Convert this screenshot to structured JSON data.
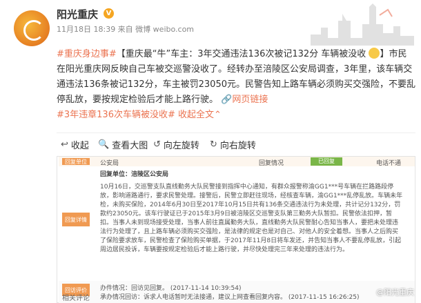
{
  "account": {
    "name": "阳光重庆",
    "verified_mark": "V",
    "meta": "11月18日 18:39 来自 微博 weibo.com"
  },
  "post": {
    "tag1": "#重庆身边事#",
    "headline": "【重庆最“牛”车主：3年交通违法136次被记132分 车辆被没收",
    "body": "】市民在阳光重庆网反映自己车被交巡警没收了。经转办至涪陵区公安局调查，3年里，该车辆交通违法136条被记132分，车主被罚23050元。民警告知上路车辆必须购买交强险，不要乱停乱放，要按规定检验后才能上路行驶。",
    "link": "网页链接",
    "tag2": "#3年违章136次车辆被没收#",
    "collapse": "收起全文"
  },
  "actions": {
    "collapse": "收起",
    "view_large": "查看大图",
    "rotate_left": "向左旋转",
    "rotate_right": "向右旋转"
  },
  "shot": {
    "gov_label": "回复单位",
    "gov": "公安局",
    "status": "回复情况",
    "status_badge": "已回复",
    "t2": "电话不通",
    "reply_label": "回复详情",
    "reply_unit": "回复单位：涪陵区公安局",
    "reply_text": "10月16日，交巡警支队直线勤务大队民警接到指挥中心通知，有群众报警称渝GG1***号车辆在拦路路段停放，影响道路通行，要求民警处理。接警后，民警立即赶往现场，经核查车辆，渝GG1***乱停乱放。车辆未年检，未购买保险，2014年6月30日至2017年10月15日共有136条交通违法行为未处理，共计记分132分，罚款约23050元。该车行驶证已于2015年3月9日被涪陵区交巡警支队第三勤务大队暂扣。民警依法扣押，暂扣。当事人未到现场接受处理，当事人前往直属勤务大队，直线勤务大队民警耐心告知当事人，要把未处理违法行为处理了，且上路车辆必须购买交强险，是法律的规定也是对自己、对他人的安全着想。当事人之后购买了保险要求放车，民警检查了保险购买单据，于2017年11月8日将车发还，并告知当事人不要乱停乱放，引起周边居民投诉，车辆要按规定检验后才能上路行驶，并尽快处理完三年来处理的违法行为。",
    "eval_label": "回访评价",
    "eval1": "办件情况：回访见回复。 (2017-11-14 10:39:54)",
    "eval2": "承办情况回访：诉求人电话暂时无法接通，建议上网查看回复内容。 (2017-11-15 16:26:25)"
  },
  "comments_label": "相关评论",
  "watermark": "@阳光重庆"
}
